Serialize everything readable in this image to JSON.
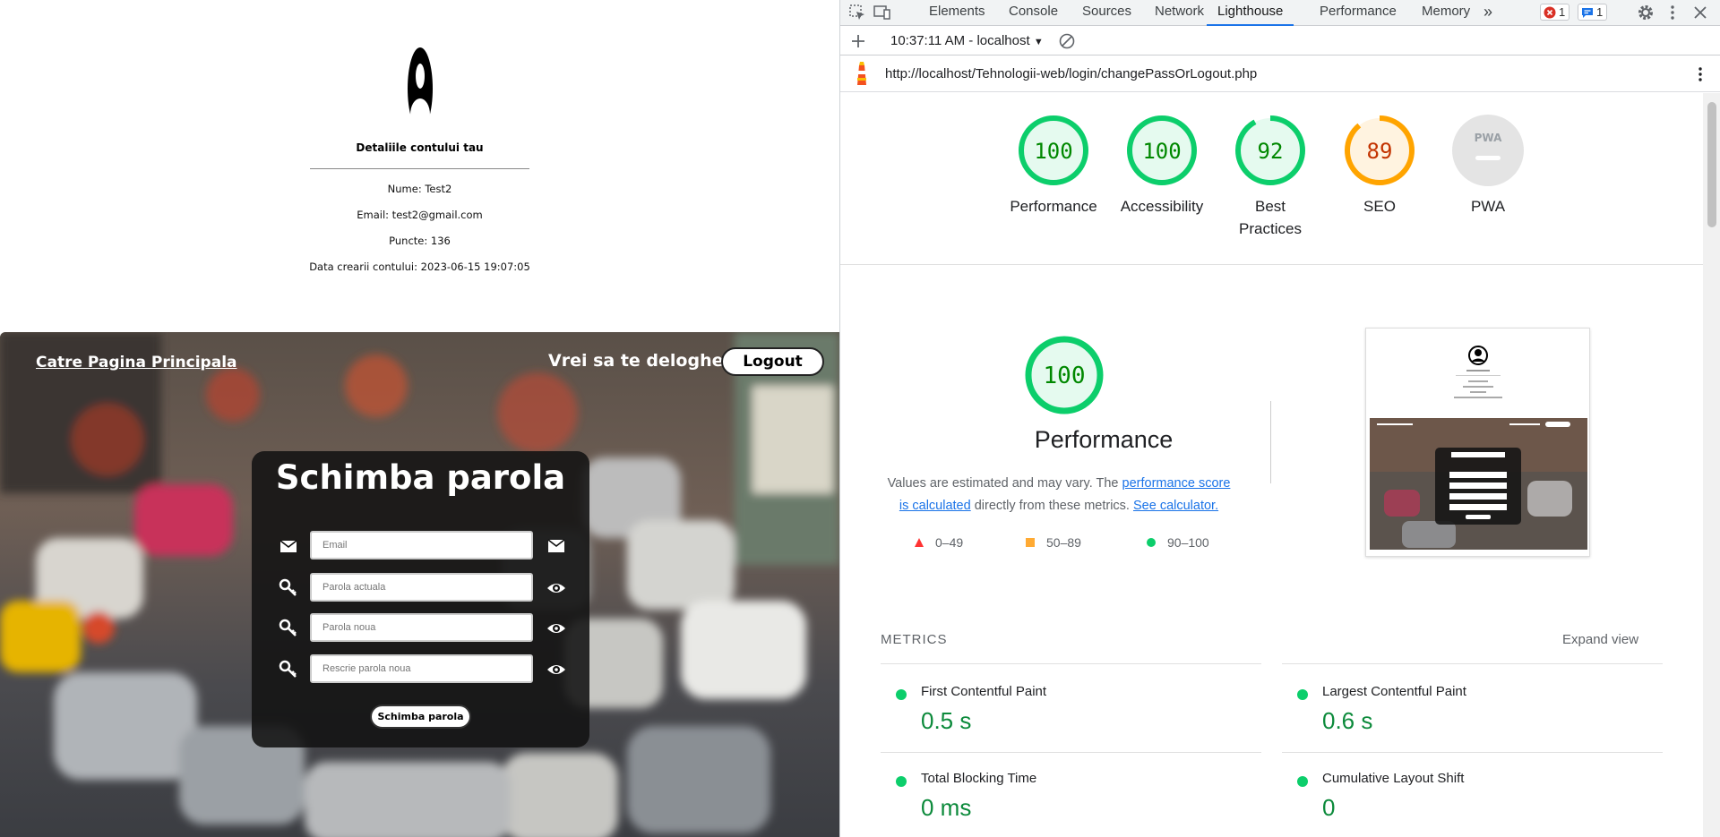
{
  "webpage": {
    "account": {
      "title": "Detaliile contului tau",
      "name_line": "Nume: Test2",
      "email_line": "Email: test2@gmail.com",
      "points_line": "Puncte: 136",
      "created_line": "Data crearii contului: 2023-06-15 19:07:05"
    },
    "nav": {
      "home_link": "Catre Pagina Principala",
      "logout_question": "Vrei sa te deloghezi?",
      "logout_button": "Logout"
    },
    "form": {
      "title": "Schimba parola",
      "email_placeholder": "Email",
      "current_password_placeholder": "Parola actuala",
      "new_password_placeholder": "Parola noua",
      "repeat_password_placeholder": "Rescrie parola noua",
      "submit_label": "Schimba parola"
    }
  },
  "devtools": {
    "tabs": [
      "Elements",
      "Console",
      "Sources",
      "Network",
      "Lighthouse",
      "Performance",
      "Memory"
    ],
    "active_tab": "Lighthouse",
    "more_tabs": "»",
    "errors_count": "1",
    "messages_count": "1",
    "run_label": "10:37:11 AM - localhost",
    "url": "http://localhost/Tehnologii-web/login/changePassOrLogout.php",
    "scores": [
      {
        "label": "Performance",
        "score": 100,
        "status": "pass"
      },
      {
        "label": "Accessibility",
        "score": 100,
        "status": "pass"
      },
      {
        "label": "Best Practices",
        "score": 92,
        "status": "pass"
      },
      {
        "label": "SEO",
        "score": 89,
        "status": "average"
      },
      {
        "label": "PWA",
        "score": null,
        "status": "na"
      }
    ],
    "pwa_badge": "PWA",
    "perf": {
      "score": "100",
      "title": "Performance",
      "desc_prefix": "Values are estimated and may vary. The ",
      "desc_link1": "performance score is calculated",
      "desc_mid": " directly from these metrics. ",
      "desc_link2": "See calculator."
    },
    "legend": {
      "fail": "0–49",
      "average": "50–89",
      "pass": "90–100"
    },
    "metrics_heading": "METRICS",
    "expand_view": "Expand view",
    "metrics": [
      {
        "name": "First Contentful Paint",
        "value": "0.5 s"
      },
      {
        "name": "Largest Contentful Paint",
        "value": "0.6 s"
      },
      {
        "name": "Total Blocking Time",
        "value": "0 ms"
      },
      {
        "name": "Cumulative Layout Shift",
        "value": "0"
      }
    ],
    "colors": {
      "pass": "#0cce6b",
      "average": "#ffa400",
      "fail": "#ff4e42",
      "accent": "#1a73e8"
    }
  }
}
